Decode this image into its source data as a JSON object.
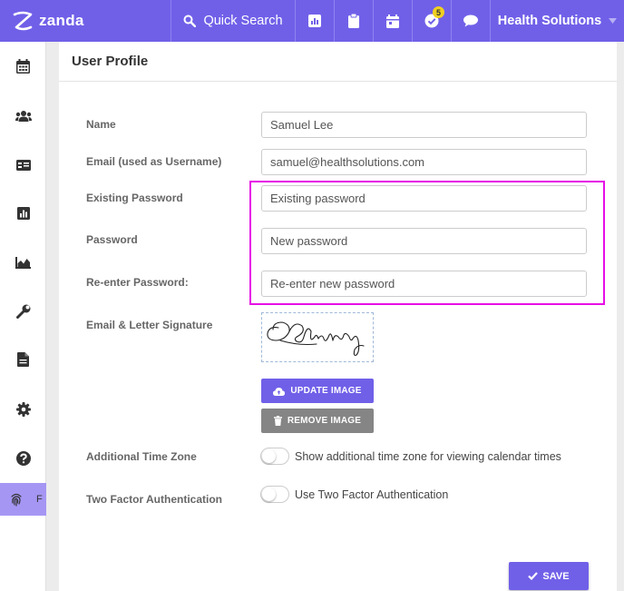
{
  "header": {
    "brand": "zanda",
    "search_label": "Quick Search",
    "tasks_badge": "5",
    "company": "Health Solutions"
  },
  "sidebar": {
    "items": [
      {
        "icon": "calendar-icon"
      },
      {
        "icon": "users-icon"
      },
      {
        "icon": "id-card-icon"
      },
      {
        "icon": "bar-chart-icon"
      },
      {
        "icon": "area-chart-icon"
      },
      {
        "icon": "wrench-icon"
      },
      {
        "icon": "document-icon"
      },
      {
        "icon": "gear-icon"
      },
      {
        "icon": "help-icon"
      }
    ],
    "active_letter": "F"
  },
  "page": {
    "title": "User Profile"
  },
  "form": {
    "name_label": "Name",
    "name_value": "Samuel Lee",
    "email_label": "Email (used as Username)",
    "email_value": "samuel@healthsolutions.com",
    "existing_password_label": "Existing Password",
    "existing_password_placeholder": "Existing password",
    "password_label": "Password",
    "password_placeholder": "New password",
    "reenter_label": "Re-enter Password:",
    "reenter_placeholder": "Re-enter new password",
    "signature_label": "Email & Letter Signature",
    "update_image_label": "UPDATE IMAGE",
    "remove_image_label": "REMOVE IMAGE",
    "timezone_label": "Additional Time Zone",
    "timezone_toggle_text": "Show additional time zone for viewing calendar times",
    "timezone_enabled": false,
    "twofa_label": "Two Factor Authentication",
    "twofa_toggle_text": "Use Two Factor Authentication",
    "twofa_enabled": false,
    "save_label": "SAVE"
  },
  "colors": {
    "brand": "#7060e8",
    "highlight": "#e60ee6",
    "remove_button": "#858585",
    "sidebar_active": "#a696f4"
  }
}
